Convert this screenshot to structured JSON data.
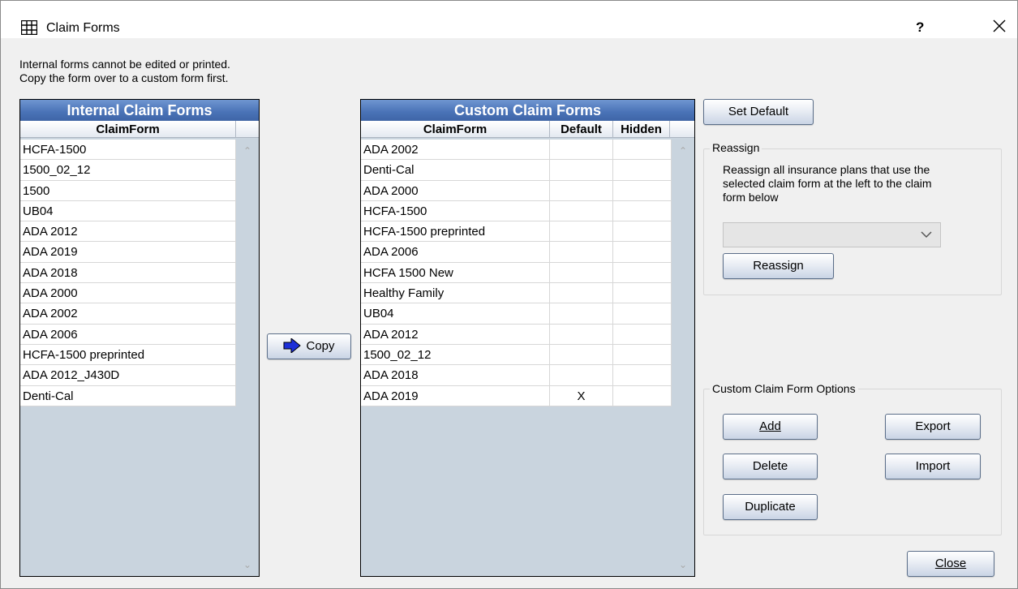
{
  "window": {
    "title": "Claim Forms",
    "help_label": "?",
    "icon": "grid-icon",
    "close_icon": "close-icon"
  },
  "note": {
    "line1": "Internal forms cannot be edited or printed.",
    "line2": "Copy the form over to a custom form first."
  },
  "internal_grid": {
    "title": "Internal Claim Forms",
    "columns": [
      "ClaimForm"
    ],
    "rows": [
      "HCFA-1500",
      "1500_02_12",
      "1500",
      "UB04",
      "ADA 2012",
      "ADA 2019",
      "ADA 2018",
      "ADA 2000",
      "ADA 2002",
      "ADA 2006",
      "HCFA-1500 preprinted",
      "ADA 2012_J430D",
      "Denti-Cal"
    ]
  },
  "copy_button": {
    "label": "Copy",
    "icon": "arrow-right-icon"
  },
  "custom_grid": {
    "title": "Custom Claim Forms",
    "columns": [
      "ClaimForm",
      "Default",
      "Hidden"
    ],
    "rows": [
      {
        "form": "ADA 2002",
        "default": "",
        "hidden": ""
      },
      {
        "form": "Denti-Cal",
        "default": "",
        "hidden": ""
      },
      {
        "form": "ADA 2000",
        "default": "",
        "hidden": ""
      },
      {
        "form": "HCFA-1500",
        "default": "",
        "hidden": ""
      },
      {
        "form": "HCFA-1500 preprinted",
        "default": "",
        "hidden": ""
      },
      {
        "form": "ADA 2006",
        "default": "",
        "hidden": ""
      },
      {
        "form": "HCFA 1500 New",
        "default": "",
        "hidden": ""
      },
      {
        "form": "Healthy Family",
        "default": "",
        "hidden": ""
      },
      {
        "form": "UB04",
        "default": "",
        "hidden": ""
      },
      {
        "form": "ADA 2012",
        "default": "",
        "hidden": ""
      },
      {
        "form": "1500_02_12",
        "default": "",
        "hidden": ""
      },
      {
        "form": "ADA 2018",
        "default": "",
        "hidden": ""
      },
      {
        "form": "ADA 2019",
        "default": "X",
        "hidden": ""
      }
    ]
  },
  "set_default_button": "Set Default",
  "reassign": {
    "group_label": "Reassign",
    "description_lines": [
      "Reassign all insurance plans that use the",
      "selected claim form at the left to the claim",
      "form below"
    ],
    "dropdown_value": "",
    "button_label": "Reassign"
  },
  "options": {
    "group_label": "Custom Claim Form Options",
    "add_label": "Add",
    "export_label": "Export",
    "delete_label": "Delete",
    "import_label": "Import",
    "duplicate_label": "Duplicate"
  },
  "close_button": "Close",
  "colors": {
    "grid_header_blue": "#4a73b7",
    "grid_empty_area": "#c9d4de",
    "button_border": "#5a6d88"
  }
}
